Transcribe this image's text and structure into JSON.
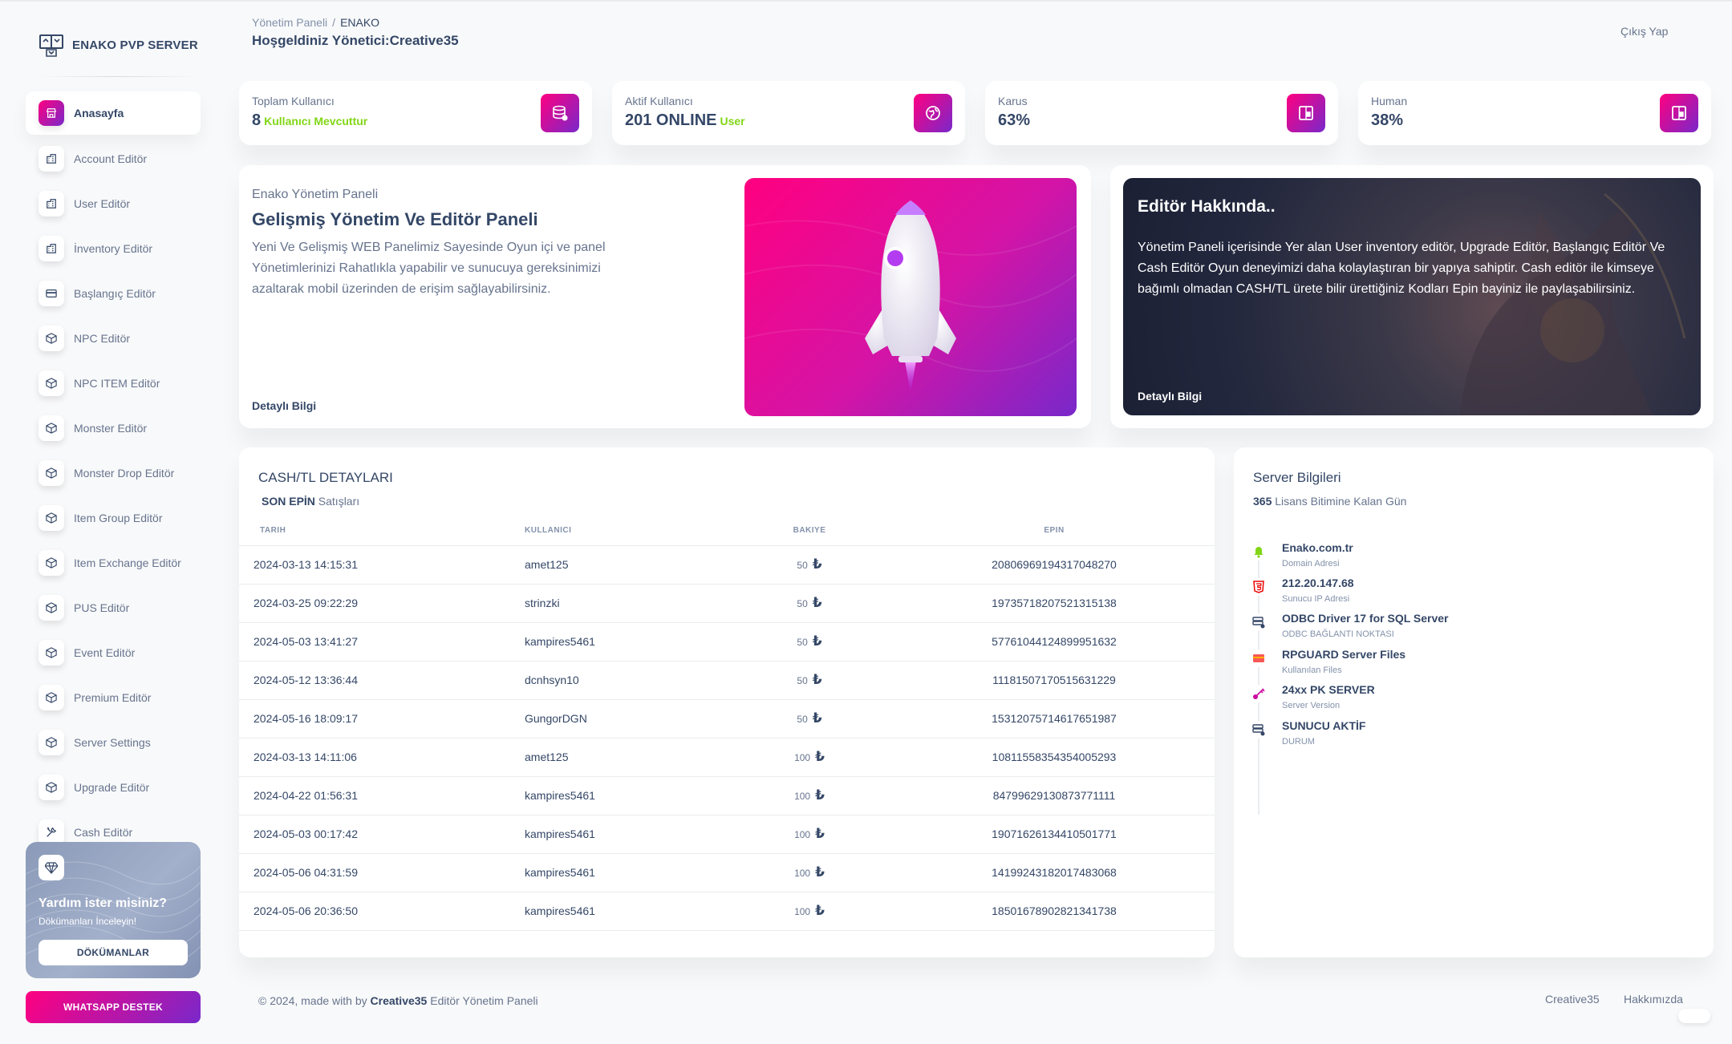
{
  "brand": {
    "name": "ENAKO PVP SERVER"
  },
  "sidebar": {
    "items": [
      {
        "label": "Anasayfa",
        "icon": "shop-icon",
        "active": true
      },
      {
        "label": "Account Editör",
        "icon": "office-icon"
      },
      {
        "label": "User Editör",
        "icon": "office-icon"
      },
      {
        "label": "İnventory Editör",
        "icon": "office-icon"
      },
      {
        "label": "Başlangıç Editör",
        "icon": "credit-card-icon"
      },
      {
        "label": "NPC Editör",
        "icon": "box-3d-icon"
      },
      {
        "label": "NPC ITEM Editör",
        "icon": "box-3d-icon"
      },
      {
        "label": "Monster Editör",
        "icon": "box-3d-icon"
      },
      {
        "label": "Monster Drop Editör",
        "icon": "box-3d-icon"
      },
      {
        "label": "Item Group Editör",
        "icon": "box-3d-icon"
      },
      {
        "label": "Item Exchange Editör",
        "icon": "box-3d-icon"
      },
      {
        "label": "PUS Editör",
        "icon": "box-3d-icon"
      },
      {
        "label": "Event Editör",
        "icon": "box-3d-icon"
      },
      {
        "label": "Premium Editör",
        "icon": "box-3d-icon"
      },
      {
        "label": "Server Settings",
        "icon": "box-3d-icon"
      },
      {
        "label": "Upgrade Editör",
        "icon": "box-3d-icon"
      },
      {
        "label": "Cash Editör",
        "icon": "tools-icon"
      }
    ],
    "help": {
      "title": "Yardım ister misiniz?",
      "subtitle": "Dökümanları İnceleyin!",
      "button": "DÖKÜMANLAR"
    },
    "whatsapp_button": "WHATSAPP DESTEK"
  },
  "header": {
    "breadcrumb": [
      "Yönetim Paneli",
      "/",
      "ENAKO"
    ],
    "welcome": "Hoşgeldiniz Yönetici:Creative35",
    "logout": "Çıkış Yap"
  },
  "stats": [
    {
      "label": "Toplam Kullanıcı",
      "value": "8",
      "suffix": "Kullanıcı Mevcuttur",
      "icon": "database-icon"
    },
    {
      "label": "Aktif Kullanıcı",
      "value": "201 ONLINE",
      "suffix": "User",
      "icon": "globe-icon"
    },
    {
      "label": "Karus",
      "value": "63%",
      "suffix": "",
      "icon": "note-icon"
    },
    {
      "label": "Human",
      "value": "38%",
      "suffix": "",
      "icon": "note-icon"
    }
  ],
  "intro": {
    "kicker": "Enako Yönetim Paneli",
    "title": "Gelişmiş Yönetim Ve Editör Paneli",
    "text": "Yeni Ve Gelişmiş WEB Panelimiz Sayesinde Oyun içi ve panel Yönetimlerinizi Rahatlıkla yapabilir ve sunucuya gereksinimizi azaltarak mobil üzerinden de erişim sağlayabilirsiniz.",
    "more": "Detaylı Bilgi"
  },
  "about": {
    "title": "Editör Hakkında..",
    "text": "Yönetim Paneli içerisinde Yer alan User inventory editör, Upgrade Editör, Başlangıç Editör Ve Cash Editör Oyun deneyimizi daha kolaylaştıran bir yapıya sahiptir. Cash editör ile kimseye bağımlı olmadan CASH/TL ürete bilir ürettiğiniz Kodları Epin bayiniz ile paylaşabilirsiniz.",
    "more": "Detaylı Bilgi"
  },
  "cash": {
    "title": "CASH/TL DETAYLARI",
    "sub_bold": "SON EPİN",
    "sub_rest": "Satışları",
    "columns": [
      "TARIH",
      "KULLANICI",
      "BAKIYE",
      "EPIN"
    ],
    "currency": "₺",
    "rows": [
      {
        "date": "2024-03-13 14:15:31",
        "user": "amet125",
        "amount": "50",
        "epin": "20806969194317048270"
      },
      {
        "date": "2024-03-25 09:22:29",
        "user": "strinzki",
        "amount": "50",
        "epin": "19735718207521315138"
      },
      {
        "date": "2024-05-03 13:41:27",
        "user": "kampires5461",
        "amount": "50",
        "epin": "57761044124899951632"
      },
      {
        "date": "2024-05-12 13:36:44",
        "user": "dcnhsyn10",
        "amount": "50",
        "epin": "11181507170515631229"
      },
      {
        "date": "2024-05-16 18:09:17",
        "user": "GungorDGN",
        "amount": "50",
        "epin": "15312075714617651987"
      },
      {
        "date": "2024-03-13 14:11:06",
        "user": "amet125",
        "amount": "100",
        "epin": "10811558354354005293"
      },
      {
        "date": "2024-04-22 01:56:31",
        "user": "kampires5461",
        "amount": "100",
        "epin": "84799629130873771111"
      },
      {
        "date": "2024-05-03 00:17:42",
        "user": "kampires5461",
        "amount": "100",
        "epin": "19071626134410501771"
      },
      {
        "date": "2024-05-06 04:31:59",
        "user": "kampires5461",
        "amount": "100",
        "epin": "14199243182017483068"
      },
      {
        "date": "2024-05-06 20:36:50",
        "user": "kampires5461",
        "amount": "100",
        "epin": "18501678902821341738"
      }
    ]
  },
  "server": {
    "title": "Server Bilgileri",
    "sub_bold": "365",
    "sub_rest": "Lisans Bitimine Kalan Gün",
    "items": [
      {
        "title": "Enako.com.tr",
        "sub": "Domain Adresi",
        "icon": "bell-icon",
        "color": "#82d616"
      },
      {
        "title": "212.20.147.68",
        "sub": "Sunucu IP Adresi",
        "icon": "html5-icon",
        "color": "#ea0606"
      },
      {
        "title": "ODBC Driver 17 for SQL Server",
        "sub": "ODBC BAĞLANTI NOKTASI",
        "icon": "server-icon",
        "color": "#344767"
      },
      {
        "title": "RPGUARD Server Files",
        "sub": "Kullanılan Files",
        "icon": "credit-card-icon",
        "color": "#f53939"
      },
      {
        "title": "24xx PK SERVER",
        "sub": "Server Version",
        "icon": "key-icon",
        "color": "#cb0c9f"
      },
      {
        "title": "SUNUCU AKTİF",
        "sub": "DURUM",
        "icon": "server-icon",
        "color": "#344767"
      }
    ]
  },
  "footer": {
    "prefix": "© 2024, made with by",
    "author": "Creative35",
    "suffix": "Editör Yönetim Paneli",
    "links": [
      "Creative35",
      "Hakkımızda"
    ]
  },
  "colors": {
    "accent_start": "#7928ca",
    "accent_end": "#ff0080",
    "text": "#344767",
    "muted": "#67748e",
    "success": "#82d616"
  }
}
